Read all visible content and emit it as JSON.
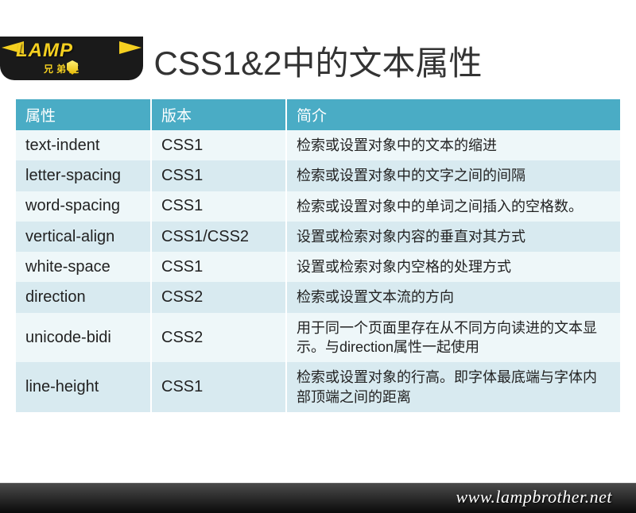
{
  "logo": {
    "main": "LAMP",
    "sub": "兄弟连"
  },
  "title": "CSS1&2中的文本属性",
  "table": {
    "headers": [
      "属性",
      "版本",
      "简介"
    ],
    "rows": [
      {
        "prop": "text-indent",
        "ver": "CSS1",
        "desc": "检索或设置对象中的文本的缩进"
      },
      {
        "prop": "letter-spacing",
        "ver": "CSS1",
        "desc": "检索或设置对象中的文字之间的间隔"
      },
      {
        "prop": "word-spacing",
        "ver": "CSS1",
        "desc": "检索或设置对象中的单词之间插入的空格数。"
      },
      {
        "prop": "vertical-align",
        "ver": "CSS1/CSS2",
        "desc": "设置或检索对象内容的垂直对其方式"
      },
      {
        "prop": "white-space",
        "ver": "CSS1",
        "desc": "设置或检索对象内空格的处理方式"
      },
      {
        "prop": "direction",
        "ver": "CSS2",
        "desc": "检索或设置文本流的方向"
      },
      {
        "prop": "unicode-bidi",
        "ver": "CSS2",
        "desc": "用于同一个页面里存在从不同方向读进的文本显示。与direction属性一起使用"
      },
      {
        "prop": "line-height",
        "ver": "CSS1",
        "desc": "检索或设置对象的行高。即字体最底端与字体内部顶端之间的距离"
      }
    ]
  },
  "footer": {
    "url": "www.lampbrother.net"
  }
}
